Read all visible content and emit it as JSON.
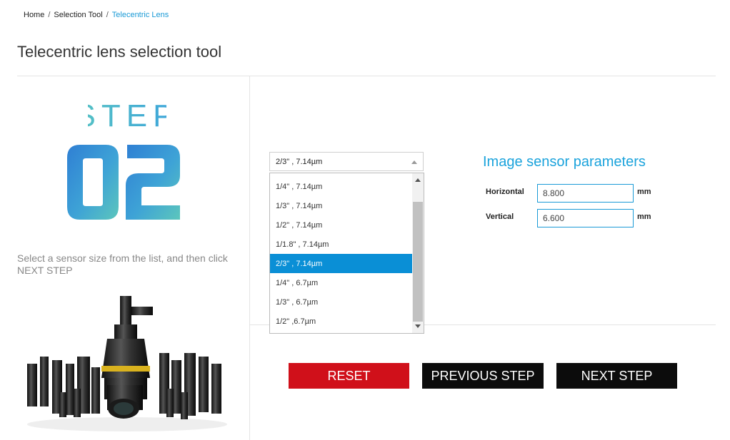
{
  "breadcrumb": {
    "home": "Home",
    "separator": "/",
    "selection_tool": "Selection Tool",
    "current": "Telecentric Lens"
  },
  "page_title": "Telecentric lens selection tool",
  "step": {
    "word": "STEP",
    "number": "02"
  },
  "instructions": "Select a sensor size from the list, and then click NEXT STEP",
  "sensor_select": {
    "value": "2/3\" , 7.14µm",
    "options": [
      "1/4\" , 7.14µm",
      "1/3\" , 7.14µm",
      "1/2\" , 7.14µm",
      "1/1.8\" , 7.14µm",
      "2/3\" , 7.14µm",
      "1/4\" , 6.7µm",
      "1/3\" , 6.7µm",
      "1/2\" ,6.7µm"
    ],
    "selected_index": 4
  },
  "image_sensor": {
    "title": "Image sensor parameters",
    "horizontal_label": "Horizontal",
    "horizontal_value": "8.800",
    "vertical_label": "Vertical",
    "vertical_value": "6.600",
    "unit": "mm"
  },
  "buttons": {
    "reset": "RESET",
    "previous": "PREVIOUS STEP",
    "next": "NEXT STEP"
  },
  "colors": {
    "accent": "#1ba3dc",
    "reset": "#d0101a",
    "dark": "#0c0c0c",
    "selected": "#0a8fd6"
  }
}
